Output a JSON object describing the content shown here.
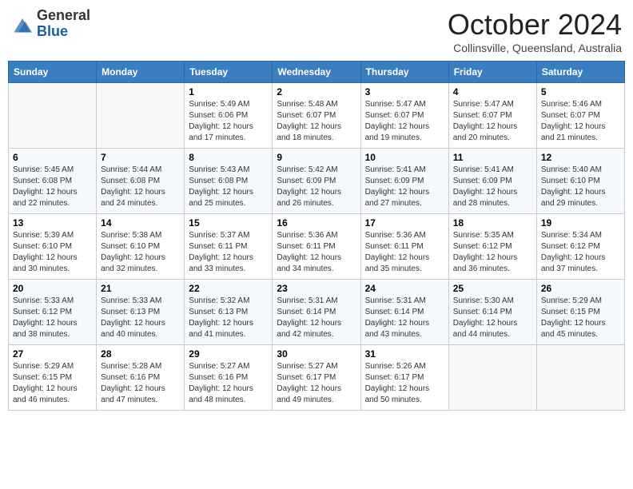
{
  "header": {
    "logo_general": "General",
    "logo_blue": "Blue",
    "month": "October 2024",
    "location": "Collinsville, Queensland, Australia"
  },
  "days_of_week": [
    "Sunday",
    "Monday",
    "Tuesday",
    "Wednesday",
    "Thursday",
    "Friday",
    "Saturday"
  ],
  "weeks": [
    [
      {
        "day": "",
        "sunrise": "",
        "sunset": "",
        "daylight": ""
      },
      {
        "day": "",
        "sunrise": "",
        "sunset": "",
        "daylight": ""
      },
      {
        "day": "1",
        "sunrise": "Sunrise: 5:49 AM",
        "sunset": "Sunset: 6:06 PM",
        "daylight": "Daylight: 12 hours and 17 minutes."
      },
      {
        "day": "2",
        "sunrise": "Sunrise: 5:48 AM",
        "sunset": "Sunset: 6:07 PM",
        "daylight": "Daylight: 12 hours and 18 minutes."
      },
      {
        "day": "3",
        "sunrise": "Sunrise: 5:47 AM",
        "sunset": "Sunset: 6:07 PM",
        "daylight": "Daylight: 12 hours and 19 minutes."
      },
      {
        "day": "4",
        "sunrise": "Sunrise: 5:47 AM",
        "sunset": "Sunset: 6:07 PM",
        "daylight": "Daylight: 12 hours and 20 minutes."
      },
      {
        "day": "5",
        "sunrise": "Sunrise: 5:46 AM",
        "sunset": "Sunset: 6:07 PM",
        "daylight": "Daylight: 12 hours and 21 minutes."
      }
    ],
    [
      {
        "day": "6",
        "sunrise": "Sunrise: 5:45 AM",
        "sunset": "Sunset: 6:08 PM",
        "daylight": "Daylight: 12 hours and 22 minutes."
      },
      {
        "day": "7",
        "sunrise": "Sunrise: 5:44 AM",
        "sunset": "Sunset: 6:08 PM",
        "daylight": "Daylight: 12 hours and 24 minutes."
      },
      {
        "day": "8",
        "sunrise": "Sunrise: 5:43 AM",
        "sunset": "Sunset: 6:08 PM",
        "daylight": "Daylight: 12 hours and 25 minutes."
      },
      {
        "day": "9",
        "sunrise": "Sunrise: 5:42 AM",
        "sunset": "Sunset: 6:09 PM",
        "daylight": "Daylight: 12 hours and 26 minutes."
      },
      {
        "day": "10",
        "sunrise": "Sunrise: 5:41 AM",
        "sunset": "Sunset: 6:09 PM",
        "daylight": "Daylight: 12 hours and 27 minutes."
      },
      {
        "day": "11",
        "sunrise": "Sunrise: 5:41 AM",
        "sunset": "Sunset: 6:09 PM",
        "daylight": "Daylight: 12 hours and 28 minutes."
      },
      {
        "day": "12",
        "sunrise": "Sunrise: 5:40 AM",
        "sunset": "Sunset: 6:10 PM",
        "daylight": "Daylight: 12 hours and 29 minutes."
      }
    ],
    [
      {
        "day": "13",
        "sunrise": "Sunrise: 5:39 AM",
        "sunset": "Sunset: 6:10 PM",
        "daylight": "Daylight: 12 hours and 30 minutes."
      },
      {
        "day": "14",
        "sunrise": "Sunrise: 5:38 AM",
        "sunset": "Sunset: 6:10 PM",
        "daylight": "Daylight: 12 hours and 32 minutes."
      },
      {
        "day": "15",
        "sunrise": "Sunrise: 5:37 AM",
        "sunset": "Sunset: 6:11 PM",
        "daylight": "Daylight: 12 hours and 33 minutes."
      },
      {
        "day": "16",
        "sunrise": "Sunrise: 5:36 AM",
        "sunset": "Sunset: 6:11 PM",
        "daylight": "Daylight: 12 hours and 34 minutes."
      },
      {
        "day": "17",
        "sunrise": "Sunrise: 5:36 AM",
        "sunset": "Sunset: 6:11 PM",
        "daylight": "Daylight: 12 hours and 35 minutes."
      },
      {
        "day": "18",
        "sunrise": "Sunrise: 5:35 AM",
        "sunset": "Sunset: 6:12 PM",
        "daylight": "Daylight: 12 hours and 36 minutes."
      },
      {
        "day": "19",
        "sunrise": "Sunrise: 5:34 AM",
        "sunset": "Sunset: 6:12 PM",
        "daylight": "Daylight: 12 hours and 37 minutes."
      }
    ],
    [
      {
        "day": "20",
        "sunrise": "Sunrise: 5:33 AM",
        "sunset": "Sunset: 6:12 PM",
        "daylight": "Daylight: 12 hours and 38 minutes."
      },
      {
        "day": "21",
        "sunrise": "Sunrise: 5:33 AM",
        "sunset": "Sunset: 6:13 PM",
        "daylight": "Daylight: 12 hours and 40 minutes."
      },
      {
        "day": "22",
        "sunrise": "Sunrise: 5:32 AM",
        "sunset": "Sunset: 6:13 PM",
        "daylight": "Daylight: 12 hours and 41 minutes."
      },
      {
        "day": "23",
        "sunrise": "Sunrise: 5:31 AM",
        "sunset": "Sunset: 6:14 PM",
        "daylight": "Daylight: 12 hours and 42 minutes."
      },
      {
        "day": "24",
        "sunrise": "Sunrise: 5:31 AM",
        "sunset": "Sunset: 6:14 PM",
        "daylight": "Daylight: 12 hours and 43 minutes."
      },
      {
        "day": "25",
        "sunrise": "Sunrise: 5:30 AM",
        "sunset": "Sunset: 6:14 PM",
        "daylight": "Daylight: 12 hours and 44 minutes."
      },
      {
        "day": "26",
        "sunrise": "Sunrise: 5:29 AM",
        "sunset": "Sunset: 6:15 PM",
        "daylight": "Daylight: 12 hours and 45 minutes."
      }
    ],
    [
      {
        "day": "27",
        "sunrise": "Sunrise: 5:29 AM",
        "sunset": "Sunset: 6:15 PM",
        "daylight": "Daylight: 12 hours and 46 minutes."
      },
      {
        "day": "28",
        "sunrise": "Sunrise: 5:28 AM",
        "sunset": "Sunset: 6:16 PM",
        "daylight": "Daylight: 12 hours and 47 minutes."
      },
      {
        "day": "29",
        "sunrise": "Sunrise: 5:27 AM",
        "sunset": "Sunset: 6:16 PM",
        "daylight": "Daylight: 12 hours and 48 minutes."
      },
      {
        "day": "30",
        "sunrise": "Sunrise: 5:27 AM",
        "sunset": "Sunset: 6:17 PM",
        "daylight": "Daylight: 12 hours and 49 minutes."
      },
      {
        "day": "31",
        "sunrise": "Sunrise: 5:26 AM",
        "sunset": "Sunset: 6:17 PM",
        "daylight": "Daylight: 12 hours and 50 minutes."
      },
      {
        "day": "",
        "sunrise": "",
        "sunset": "",
        "daylight": ""
      },
      {
        "day": "",
        "sunrise": "",
        "sunset": "",
        "daylight": ""
      }
    ]
  ]
}
